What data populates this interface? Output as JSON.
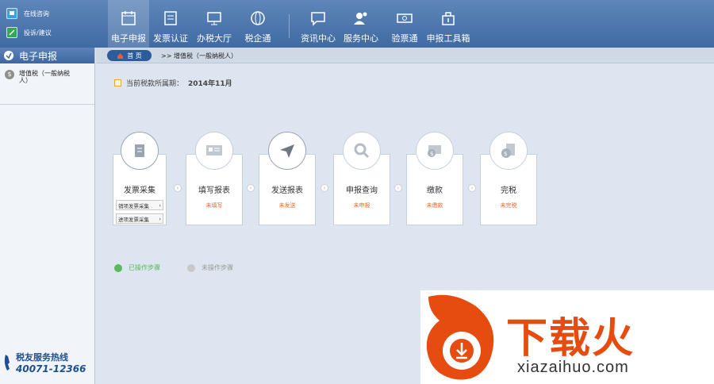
{
  "quicklinks": [
    {
      "label": "在线咨询",
      "icon": "chat-icon"
    },
    {
      "label": "投诉/建议",
      "icon": "edit-icon"
    }
  ],
  "nav": [
    {
      "label": "电子申报",
      "icon": "calendar-icon",
      "active": true
    },
    {
      "label": "发票认证",
      "icon": "document-icon"
    },
    {
      "label": "办税大厅",
      "icon": "monitor-icon"
    },
    {
      "label": "税企通",
      "icon": "globe-icon"
    },
    {
      "label": "资讯中心",
      "icon": "message-icon"
    },
    {
      "label": "服务中心",
      "icon": "user-service-icon"
    },
    {
      "label": "验票通",
      "icon": "ticket-icon"
    },
    {
      "label": "申报工具箱",
      "icon": "toolbox-icon"
    }
  ],
  "sidebar": {
    "header": "电子申报",
    "item": "增值税（一般纳税人）",
    "hotline_title": "税友服务热线",
    "hotline_number": "40071-12366"
  },
  "breadcrumb": {
    "home": "首 页",
    "sep": ">>",
    "current": "增值税（一般纳税人）"
  },
  "period": {
    "label": "当前税款所属期：",
    "value": "2014年11月"
  },
  "steps": [
    {
      "title": "发票采集",
      "icon": "invoice-collect-icon",
      "sub": [
        "销项发票采集",
        "进项发票采集"
      ]
    },
    {
      "title": "填写报表",
      "icon": "form-icon",
      "status": "未填写"
    },
    {
      "title": "发送报表",
      "icon": "send-icon",
      "status": "未发送"
    },
    {
      "title": "申报查询",
      "icon": "search-icon",
      "status": "未申报"
    },
    {
      "title": "缴款",
      "icon": "payment-icon",
      "status": "未缴款"
    },
    {
      "title": "完税",
      "icon": "tax-complete-icon",
      "status": "未完税"
    }
  ],
  "legend": {
    "done": "已操作步骤",
    "todo": "未操作步骤"
  },
  "colors": {
    "done": "#5cb85c",
    "todo": "#c8c8c8",
    "status": "#e36a2e",
    "accent": "#3f6aa3"
  },
  "watermark": {
    "brand": "下载火",
    "url": "xiazaihuo.com"
  }
}
